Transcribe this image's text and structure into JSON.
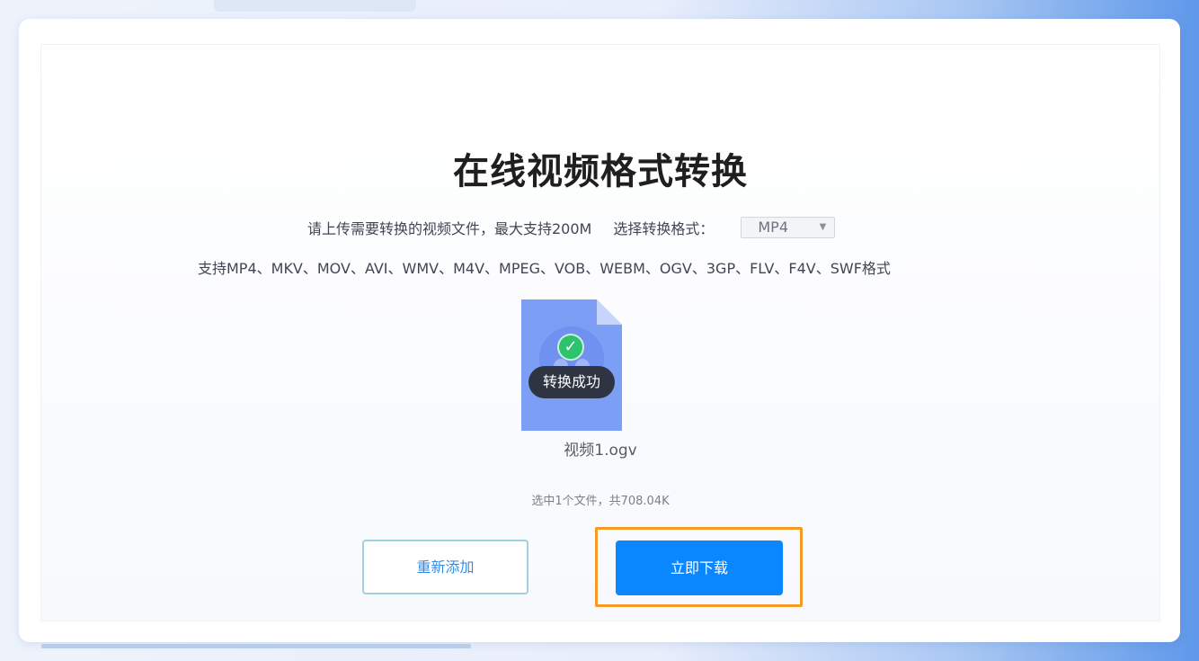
{
  "page": {
    "title": "在线视频格式转换",
    "upload_hint": "请上传需要转换的视频文件，最大支持200M",
    "format_label": "选择转换格式：",
    "format_selected": "MP4",
    "supported_formats": "支持MP4、MKV、MOV、AVI、WMV、M4V、MPEG、VOB、WEBM、OGV、3GP、FLV、F4V、SWF格式"
  },
  "file": {
    "status": "转换成功",
    "name": "视频1.ogv",
    "icon": "video-file-icon"
  },
  "selection_info": "选中1个文件，共708.04K",
  "buttons": {
    "readd": "重新添加",
    "download": "立即下载"
  },
  "colors": {
    "primary": "#0a86ff",
    "highlight": "#f59a23",
    "success": "#2cc26e"
  }
}
